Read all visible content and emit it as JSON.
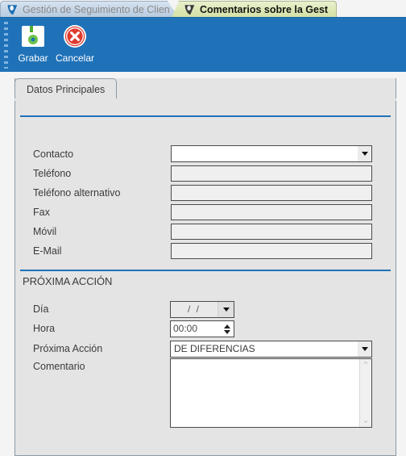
{
  "tabs": [
    {
      "label": "Gestión de Seguimiento de Cliente..",
      "icon": "app-shield-icon",
      "active": false
    },
    {
      "label": "Comentarios sobre la Gestión",
      "icon": "app-shield-icon",
      "active": true
    }
  ],
  "toolbar": {
    "save_label": "Grabar",
    "save_icon": "floppy-disk-icon",
    "cancel_label": "Cancelar",
    "cancel_icon": "cancel-circle-icon",
    "background_color": "#1f72b8"
  },
  "panel": {
    "tab_label": "Datos Principales",
    "accent_color": "#1f72b8"
  },
  "main_section": {
    "fields": [
      {
        "label": "Contacto",
        "type": "combo",
        "value": ""
      },
      {
        "label": "Teléfono",
        "type": "readonly",
        "value": ""
      },
      {
        "label": "Teléfono alternativo",
        "type": "readonly",
        "value": ""
      },
      {
        "label": "Fax",
        "type": "readonly",
        "value": ""
      },
      {
        "label": "Móvil",
        "type": "readonly",
        "value": ""
      },
      {
        "label": "E-Mail",
        "type": "readonly",
        "value": ""
      }
    ]
  },
  "next_action_section": {
    "title": "PRÓXIMA ACCIÓN",
    "day_label": "Día",
    "day_value": "/  /",
    "hour_label": "Hora",
    "hour_value": "00:00",
    "action_label": "Próxima Acción",
    "action_value": "DE DIFERENCIAS",
    "comment_label": "Comentario",
    "comment_value": "",
    "scroll_up_glyph": "⌃",
    "scroll_down_glyph": "⌄"
  }
}
